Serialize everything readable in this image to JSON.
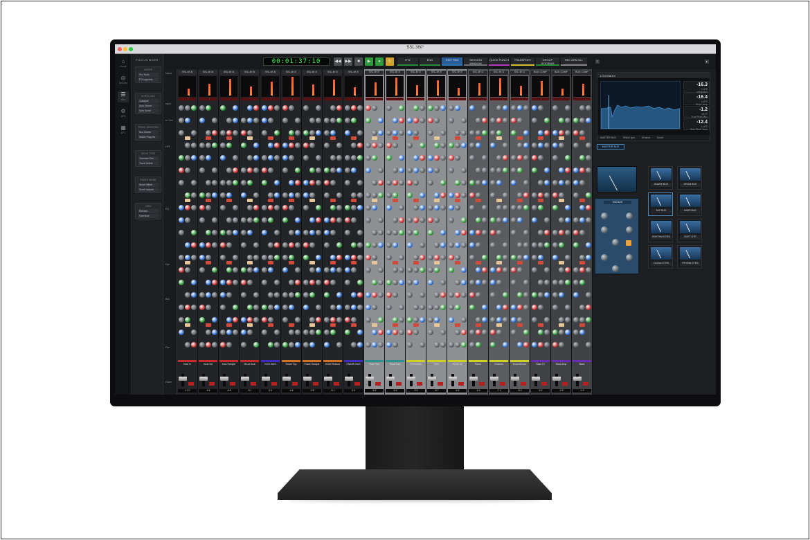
{
  "window": {
    "title": "SSL 360°",
    "traffic_colors": [
      "#ff5f57",
      "#febc2e",
      "#28c840"
    ]
  },
  "rail": {
    "items": [
      {
        "icon": "home-icon",
        "label": "Home"
      },
      {
        "icon": "devices-icon",
        "label": "Devices"
      },
      {
        "icon": "mixer-icon",
        "label": "Mix"
      },
      {
        "icon": "settings-icon",
        "label": "UF8"
      },
      {
        "icon": "grid-icon",
        "label": "UF1"
      }
    ]
  },
  "plugin_panel": {
    "title": "PLUG-IN MIXER",
    "groups": [
      {
        "heading": "HOSTS",
        "items": [
          "Pro Tools",
          "PT/Logic/etc"
        ]
      },
      {
        "heading": "SCROLLING",
        "items": [
          "Collapse",
          "Auto Select",
          "Auto Scroll"
        ]
      },
      {
        "heading": "TRACK DELETING",
        "items": [
          "Bus Delete",
          "Match Plug-ins"
        ]
      },
      {
        "heading": "MOVE TYPE",
        "items": [
          "Transient Rel",
          "Track Delete"
        ]
      },
      {
        "heading": "FADER MODE",
        "items": [
          "Scroll Offset",
          "Scroll Include"
        ]
      },
      {
        "heading": "VIEW",
        "items": [
          "Refresh",
          "Overview"
        ]
      }
    ]
  },
  "transport": {
    "timecode": "00:01:37:10",
    "buttons": [
      "◀◀",
      "▶▶",
      "■",
      "▶",
      "●",
      "↻"
    ],
    "tabs": [
      {
        "label": "RTZ",
        "color": "#2b8b3a"
      },
      {
        "label": "END",
        "color": "#2b8b3a"
      },
      {
        "label": "EDIT PAN",
        "color": "#2d6fb3",
        "active": true
      },
      {
        "label": "SESSION WINDOW",
        "color": "#6f6f6f"
      },
      {
        "label": "QUICK PUNCH",
        "color": "#b03ab6"
      },
      {
        "label": "TRANSPORT",
        "color": "#d8c032"
      },
      {
        "label": "GROUP SYSTEMS",
        "color": "#2b8b3a"
      },
      {
        "label": "REC ARM ALL",
        "color": "#888888"
      }
    ]
  },
  "strip_meta_labels": [
    "Name",
    "Input",
    "In Trim",
    "HPF",
    "EQ",
    "Dyn",
    "Bus",
    "Pan",
    "Fader"
  ],
  "mixer": {
    "channels": [
      {
        "name": "SSL 4K B",
        "caption": "Kick In",
        "group": "dark",
        "color": "#c62a2a",
        "value": "-17.0"
      },
      {
        "name": "SSL 4K B",
        "caption": "Kick Out",
        "group": "dark",
        "color": "#c62a2a",
        "value": "-9.4"
      },
      {
        "name": "SSL 4K B",
        "caption": "Kick Sample",
        "group": "dark",
        "color": "#c62a2a",
        "value": "-8.8"
      },
      {
        "name": "SSL 4K B",
        "caption": "Mood Kick",
        "group": "dark",
        "color": "#c62a2a",
        "value": "-9.1"
      },
      {
        "name": "SSL 4K B",
        "caption": "KICK BUS",
        "group": "dark",
        "color": "#3f2ac6",
        "value": "0.0"
      },
      {
        "name": "SSL 4K E",
        "caption": "Snare Top",
        "group": "dark",
        "color": "#d07020",
        "value": "-4.6"
      },
      {
        "name": "SSL 4K E",
        "caption": "Snare Sample",
        "group": "dark",
        "color": "#d07020",
        "value": "-2.8"
      },
      {
        "name": "SSL 4K E",
        "caption": "Snare Bottom",
        "group": "dark",
        "color": "#d07020",
        "value": "-5.1"
      },
      {
        "name": "SSL 4K E",
        "caption": "SNARE BUS",
        "group": "dark",
        "color": "#3f2ac6",
        "value": "0.0"
      },
      {
        "name": "SSL 4K E",
        "caption": "Floor Tom",
        "group": "light",
        "color": "#2a8f8f",
        "value": "-6.2"
      },
      {
        "name": "SSL 4K E",
        "caption": "Rack Tom",
        "group": "light",
        "color": "#2a8f8f",
        "value": "-6.4"
      },
      {
        "name": "SSL 4K E",
        "caption": "Overheads",
        "group": "light",
        "color": "#cfcf2a",
        "value": "-3.0"
      },
      {
        "name": "SSL 4K E",
        "caption": "Hats",
        "group": "light",
        "color": "#cfcf2a",
        "value": "-8.7"
      },
      {
        "name": "SSL 4K E",
        "caption": "Room all",
        "group": "light",
        "color": "#cfcf2a",
        "value": "-4.4"
      },
      {
        "name": "SSL 4K G",
        "caption": "Room",
        "group": "midgray",
        "color": "#cfcf2a",
        "value": "-5.9"
      },
      {
        "name": "SSL 4K G",
        "caption": "Crashes",
        "group": "midgray",
        "color": "#cfcf2a",
        "value": "-7.1"
      },
      {
        "name": "SSL 4K G",
        "caption": "DrumsRoom",
        "group": "midgray",
        "color": "#cfcf2a",
        "value": "-5.0"
      },
      {
        "name": "BUS COMP",
        "caption": "Bass DI",
        "group": "midgray2",
        "color": "#6a2ab6",
        "value": "-3.2"
      },
      {
        "name": "BUS COMP",
        "caption": "Bass Amp",
        "group": "midgray2",
        "color": "#6a2ab6",
        "value": "-2.5"
      },
      {
        "name": "BUS COMP",
        "caption": "Bass",
        "group": "midgray2",
        "color": "#6a2ab6",
        "value": "-1.9"
      }
    ]
  },
  "loudness": {
    "title": "LOUDNESS",
    "values": [
      {
        "value": "-16.3",
        "unit": "LUFS",
        "label": "Integrated"
      },
      {
        "value": "-16.4",
        "unit": "LUFS",
        "label": "Short Term"
      },
      {
        "value": "-1.2",
        "unit": "dBTP",
        "label": "True Peak Max"
      },
      {
        "value": "-12.4",
        "unit": "LUFS",
        "label": "Max Short Term"
      }
    ],
    "footer": [
      "MASTER BUS",
      "ONNX Ipro",
      "30 secs",
      "Scroll"
    ]
  },
  "master": {
    "bus_button": "MASTER BUS",
    "main_label": "MIX BUS",
    "buses": [
      "SNARE BUS",
      "DRUM BUS",
      "MIX BUS",
      "BASS BUS",
      "RHYTHM GTRS",
      "SOFT GTR",
      "CLEAN GTRS",
      "RHYMN GTRS"
    ]
  }
}
